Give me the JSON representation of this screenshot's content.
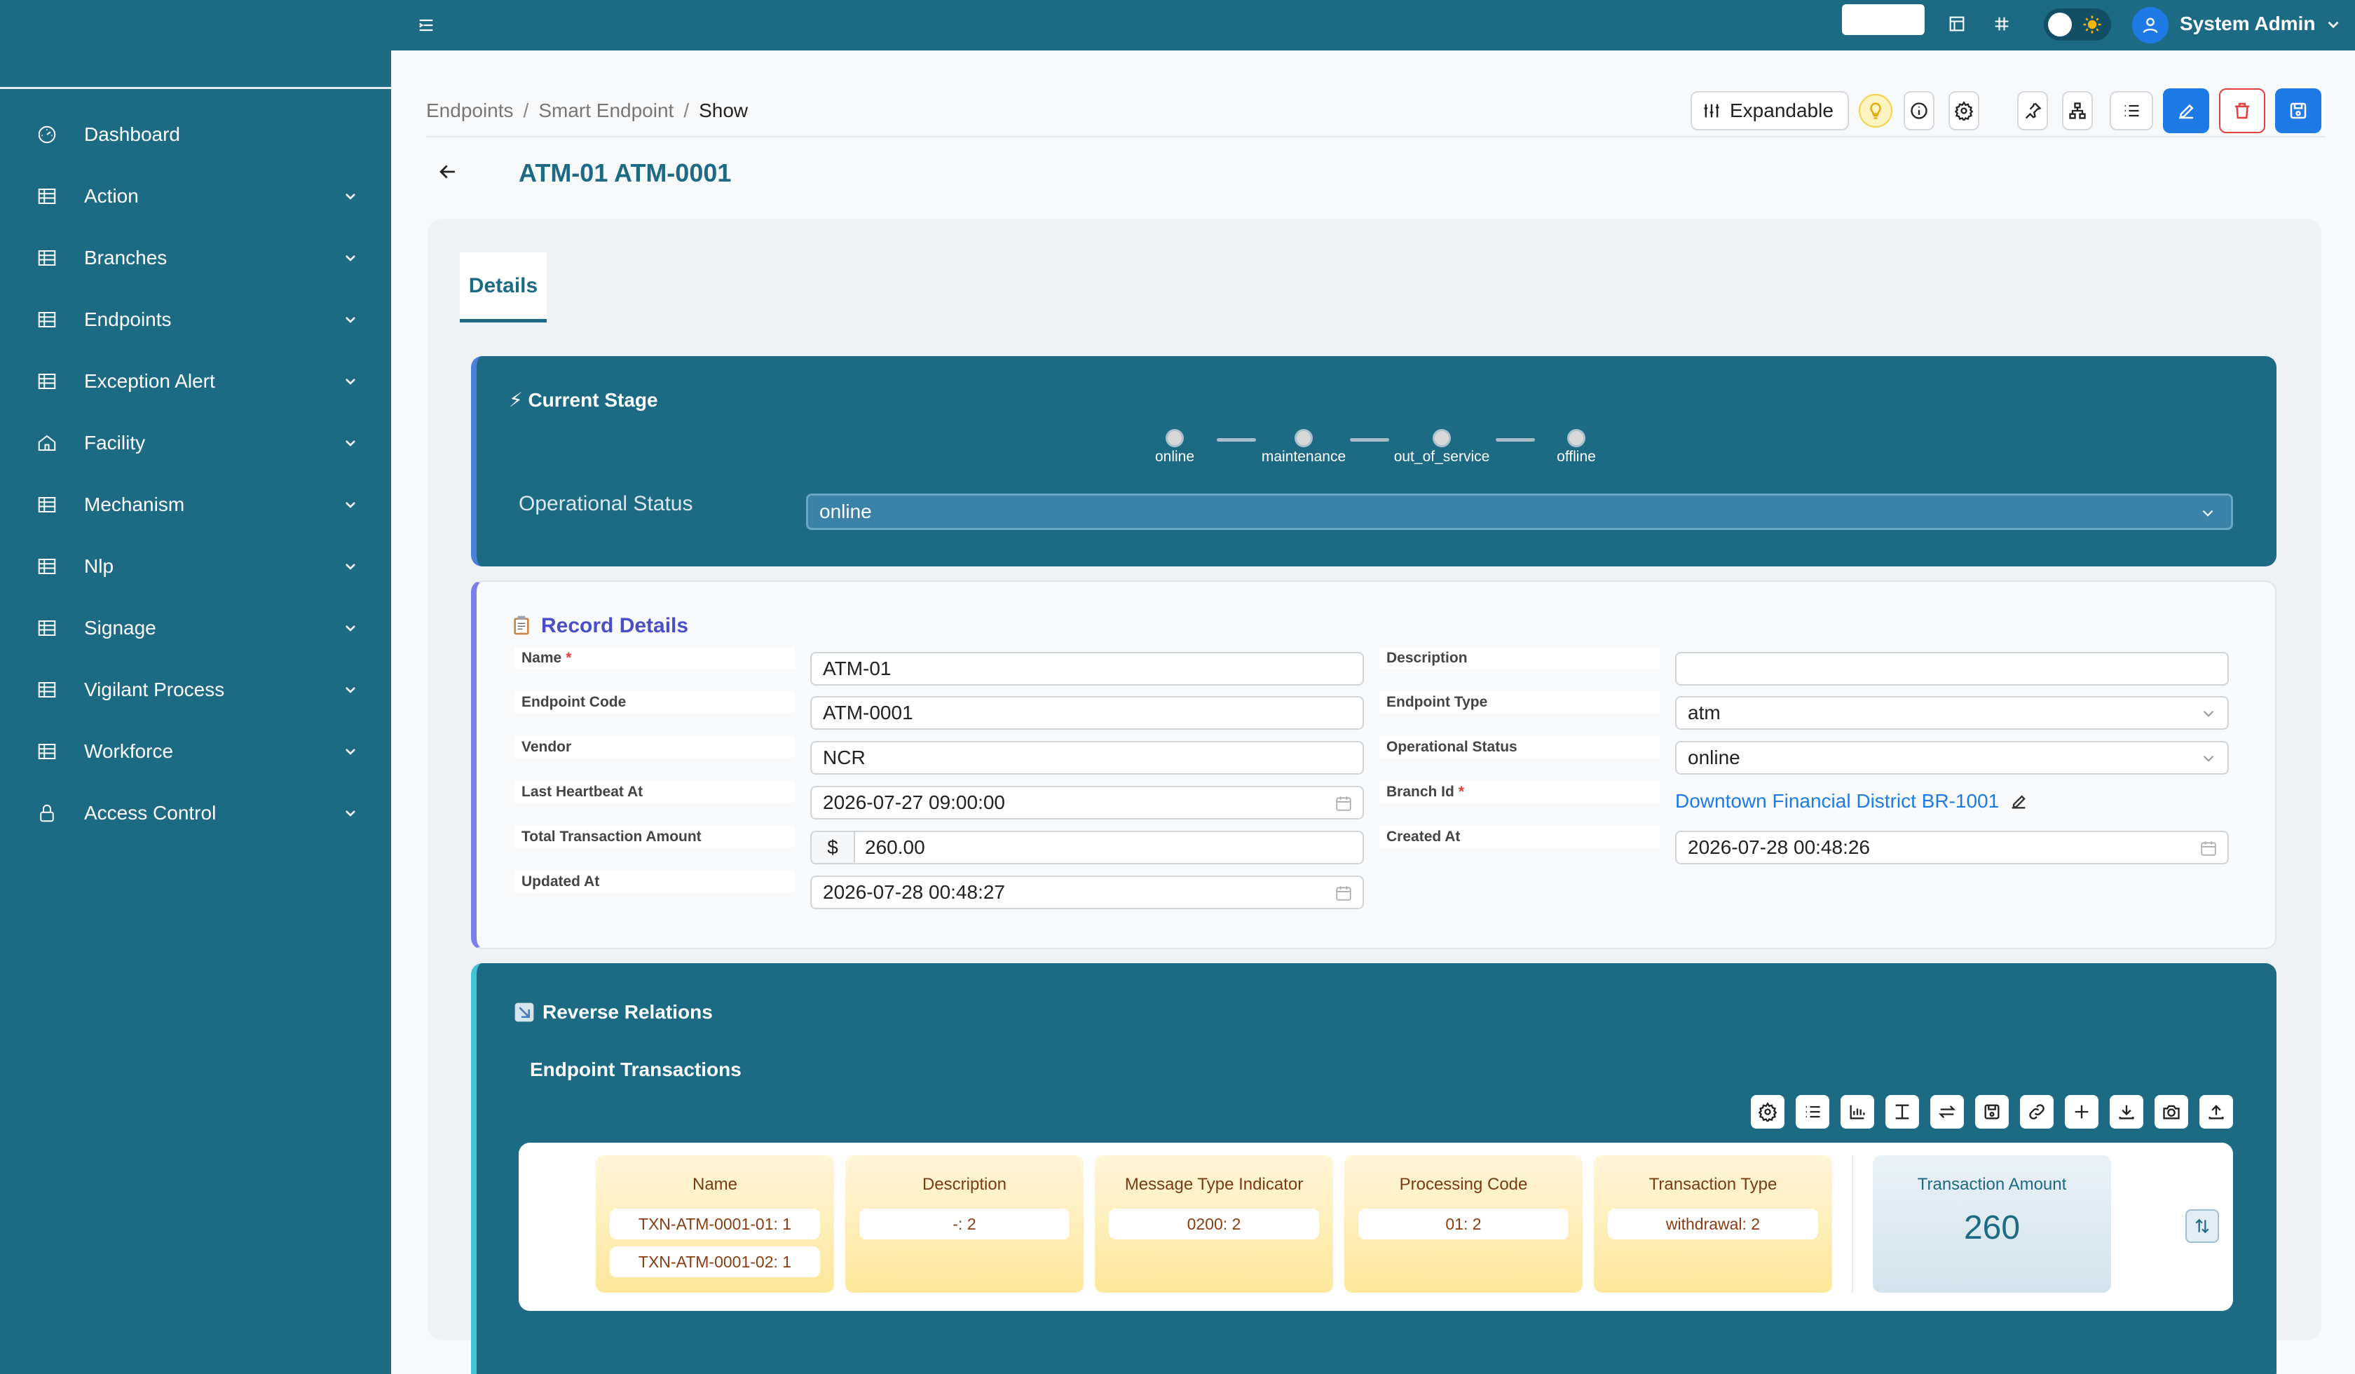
{
  "sidebar": {
    "items": [
      {
        "label": "Dashboard",
        "icon": "gauge-icon"
      },
      {
        "label": "Action",
        "icon": "table-icon"
      },
      {
        "label": "Branches",
        "icon": "table-icon"
      },
      {
        "label": "Endpoints",
        "icon": "table-icon"
      },
      {
        "label": "Exception Alert",
        "icon": "table-icon"
      },
      {
        "label": "Facility",
        "icon": "home-icon"
      },
      {
        "label": "Mechanism",
        "icon": "table-icon"
      },
      {
        "label": "Nlp",
        "icon": "table-icon"
      },
      {
        "label": "Signage",
        "icon": "table-icon"
      },
      {
        "label": "Vigilant Process",
        "icon": "table-icon"
      },
      {
        "label": "Workforce",
        "icon": "table-icon"
      },
      {
        "label": "Access Control",
        "icon": "lock-icon"
      }
    ]
  },
  "topbar": {
    "user_name": "System Admin",
    "search_value": ""
  },
  "breadcrumb": {
    "items": [
      "Endpoints",
      "Smart Endpoint",
      "Show"
    ]
  },
  "toolbar": {
    "expandable_label": "Expandable"
  },
  "page": {
    "title": "ATM-01 ATM-0001"
  },
  "tabs": {
    "details": "Details"
  },
  "stage": {
    "title": "⚡ Current Stage",
    "steps": [
      "online",
      "maintenance",
      "out_of_service",
      "offline"
    ],
    "status_label": "Operational Status",
    "status_value": "online"
  },
  "record": {
    "title": "Record Details",
    "fields": {
      "name": {
        "label": "Name",
        "value": "ATM-01"
      },
      "endpoint_code": {
        "label": "Endpoint Code",
        "value": "ATM-0001"
      },
      "vendor": {
        "label": "Vendor",
        "value": "NCR"
      },
      "last_heartbeat_at": {
        "label": "Last Heartbeat At",
        "value": "2026-07-27 09:00:00"
      },
      "total_transaction_amount": {
        "label": "Total Transaction Amount",
        "currency": "$",
        "value": "260.00"
      },
      "updated_at": {
        "label": "Updated At",
        "value": "2026-07-28 00:48:27"
      },
      "description": {
        "label": "Description",
        "value": ""
      },
      "endpoint_type": {
        "label": "Endpoint Type",
        "value": "atm"
      },
      "operational_status": {
        "label": "Operational Status",
        "value": "online"
      },
      "branch_id": {
        "label": "Branch Id",
        "value": "Downtown Financial District BR-1001"
      },
      "created_at": {
        "label": "Created At",
        "value": "2026-07-28 00:48:26"
      }
    }
  },
  "reverse": {
    "title": "Reverse Relations",
    "subtitle": "Endpoint Transactions",
    "columns": [
      {
        "header": "Name",
        "values": [
          "TXN-ATM-0001-01: 1",
          "TXN-ATM-0001-02: 1"
        ]
      },
      {
        "header": "Description",
        "values": [
          "-: 2"
        ]
      },
      {
        "header": "Message Type Indicator",
        "values": [
          "0200: 2"
        ]
      },
      {
        "header": "Processing Code",
        "values": [
          "01: 2"
        ]
      },
      {
        "header": "Transaction Type",
        "values": [
          "withdrawal: 2"
        ]
      }
    ],
    "amount": {
      "label": "Transaction Amount",
      "value": "260"
    }
  },
  "colors": {
    "primary": "#1d6a85",
    "blue_button": "#1e7be6",
    "delete_red": "#e43f3f",
    "link": "#1e7be6",
    "stage_accent": "#4a80d8",
    "record_accent": "#7b7ee8",
    "reverse_accent": "#42c3d6"
  }
}
